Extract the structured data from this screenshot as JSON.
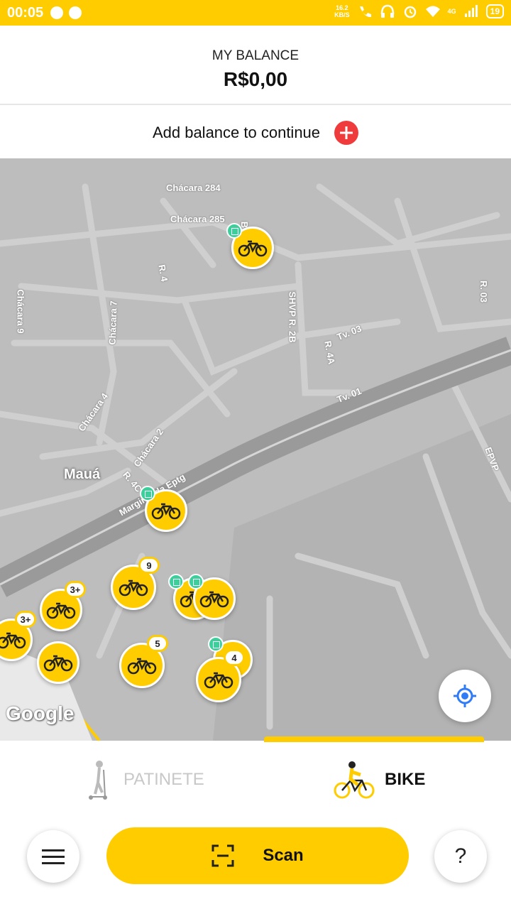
{
  "status_bar": {
    "time": "00:05",
    "net_speed_value": "16.2",
    "net_speed_unit": "KB/S",
    "network": "4G",
    "battery": "19"
  },
  "balance": {
    "label": "MY BALANCE",
    "amount": "R$0,00"
  },
  "add_balance": {
    "text": "Add balance to continue"
  },
  "map": {
    "place": "Mauá",
    "streets": [
      "Chácara 284",
      "Chácara 285",
      "R. 4",
      "Chácara 9",
      "Chácara 7",
      "SHVP R. 2B",
      "R. 4A",
      "Tv. 03",
      "Tv. 01",
      "R. 03",
      "Chácara 4",
      "Chácara 2",
      "R. 4C",
      "Marginal da Eptg",
      "EPVP",
      "B"
    ],
    "pin_counts": [
      "9",
      "3+",
      "3+",
      "5",
      "4"
    ],
    "attribution": "Google"
  },
  "modes": {
    "patinete": "PATINETE",
    "bike": "BIKE"
  },
  "actions": {
    "scan": "Scan",
    "help": "?"
  },
  "colors": {
    "brand_yellow": "#ffcc00",
    "add_red": "#ef3b3b",
    "gift_green": "#3ccf9c",
    "locate_blue": "#2f7cf6"
  }
}
